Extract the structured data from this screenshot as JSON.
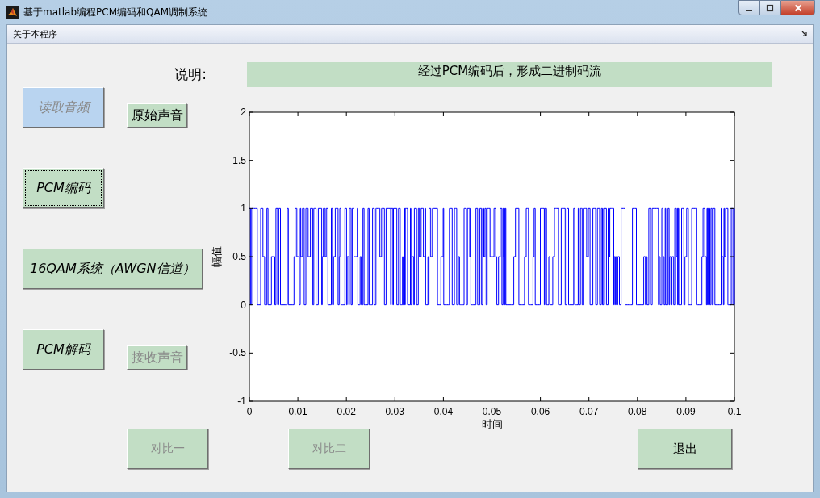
{
  "window": {
    "title": "基于matlab编程PCM编码和QAM调制系统"
  },
  "menu": [
    {
      "label": "关于本程序"
    }
  ],
  "description": {
    "label": "说明:",
    "text": "经过PCM编码后，形成二进制码流"
  },
  "left_panel": {
    "rows": [
      {
        "buttons": [
          {
            "label": "读取音频",
            "kind": "step",
            "disabled": true,
            "focused": false,
            "highlighted": true
          },
          {
            "label": "原始声音",
            "kind": "play",
            "disabled": false,
            "focused": false,
            "highlighted": false
          }
        ]
      },
      {
        "buttons": [
          {
            "label": "PCM编码",
            "kind": "step",
            "disabled": false,
            "focused": true,
            "highlighted": false
          }
        ]
      },
      {
        "buttons": [
          {
            "label": "16QAM系统（AWGN信道）",
            "kind": "step",
            "disabled": false,
            "focused": false,
            "highlighted": false
          }
        ]
      },
      {
        "buttons": [
          {
            "label": "PCM解码",
            "kind": "step",
            "disabled": false,
            "focused": false,
            "highlighted": false
          },
          {
            "label": "接收声音",
            "kind": "play",
            "disabled": true,
            "focused": false,
            "highlighted": false
          }
        ]
      }
    ]
  },
  "plot": {
    "ylabel": "幅值",
    "xlabel": "时间",
    "yticks": [
      "2",
      "1.5",
      "1",
      "0.5",
      "0",
      "-0.5",
      "-1"
    ],
    "xticks": [
      "0",
      "0.01",
      "0.02",
      "0.03",
      "0.04",
      "0.05",
      "0.06",
      "0.07",
      "0.08",
      "0.09",
      "0.1"
    ]
  },
  "bottom_buttons": [
    {
      "label": "对比一",
      "kind": "compare",
      "disabled": true,
      "focused": false,
      "highlighted": false
    },
    {
      "label": "对比二",
      "kind": "compare",
      "disabled": true,
      "focused": false,
      "highlighted": false
    },
    {
      "label": "退出",
      "kind": "exit",
      "disabled": false,
      "focused": false,
      "highlighted": false
    }
  ]
}
